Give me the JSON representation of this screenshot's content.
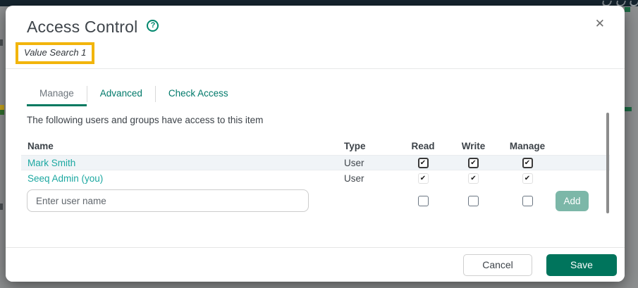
{
  "glyphs": {
    "help": "?",
    "close": "✕",
    "check": "✔"
  },
  "modal": {
    "title": "Access Control",
    "item_name": "Value Search 1",
    "tabs": [
      {
        "label": "Manage",
        "active": true
      },
      {
        "label": "Advanced",
        "active": false
      },
      {
        "label": "Check Access",
        "active": false
      }
    ],
    "description": "The following users and groups have access to this item",
    "table": {
      "headers": [
        "Name",
        "Type",
        "Read",
        "Write",
        "Manage"
      ],
      "rows": [
        {
          "name": "Mark Smith",
          "type": "User",
          "read": true,
          "write": true,
          "manage": true,
          "editable": true
        },
        {
          "name": "Seeq Admin (you)",
          "type": "User",
          "read": true,
          "write": true,
          "manage": true,
          "editable": false
        }
      ]
    },
    "add_row": {
      "placeholder": "Enter user name",
      "read": false,
      "write": false,
      "manage": false,
      "add_label": "Add",
      "add_enabled": false
    },
    "footer": {
      "cancel_label": "Cancel",
      "save_label": "Save"
    }
  },
  "colors": {
    "accent_teal": "#007960",
    "link_teal": "#1ca8a1",
    "highlight_yellow": "#f2b50c",
    "save_green": "#00745c",
    "add_muted_green": "#7cb7a8",
    "topbar_dark": "#15242e",
    "backdrop_gray": "#8d8f90",
    "row_alt_bg": "#f0f4f7"
  }
}
